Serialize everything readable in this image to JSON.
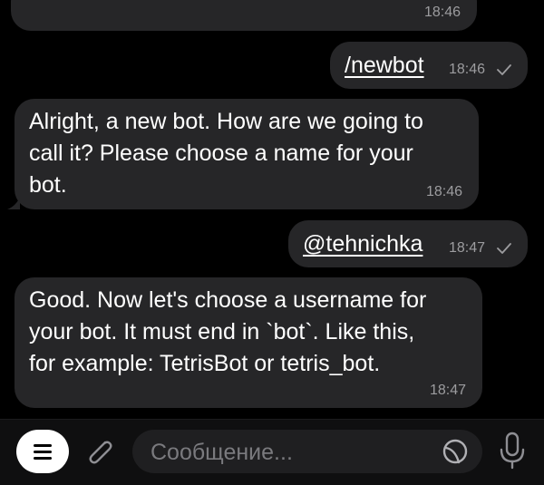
{
  "messages": [
    {
      "direction": "in",
      "text": "",
      "time": "18:46"
    },
    {
      "direction": "out",
      "text": "/newbot",
      "time": "18:46"
    },
    {
      "direction": "in",
      "text": "Alright, a new bot. How are we going to\ncall it? Please choose a name for your\nbot.",
      "time": "18:46"
    },
    {
      "direction": "out",
      "text": "@tehnichka",
      "time": "18:47"
    },
    {
      "direction": "in",
      "text": "Good. Now let's choose a username for\nyour bot. It must end in `bot`. Like this,\nfor example: TetrisBot or tetris_bot.",
      "time": "18:47"
    }
  ],
  "input": {
    "placeholder": "Сообщение..."
  },
  "icons": {
    "menu": "menu-icon",
    "attach": "paperclip-icon",
    "sticker": "sticker-icon",
    "mic": "microphone-icon",
    "check": "checkmark-icon"
  },
  "colors": {
    "background": "#000000",
    "bubble": "#262628",
    "time": "#9c9c9f",
    "input_bar": "#0f0f10"
  }
}
